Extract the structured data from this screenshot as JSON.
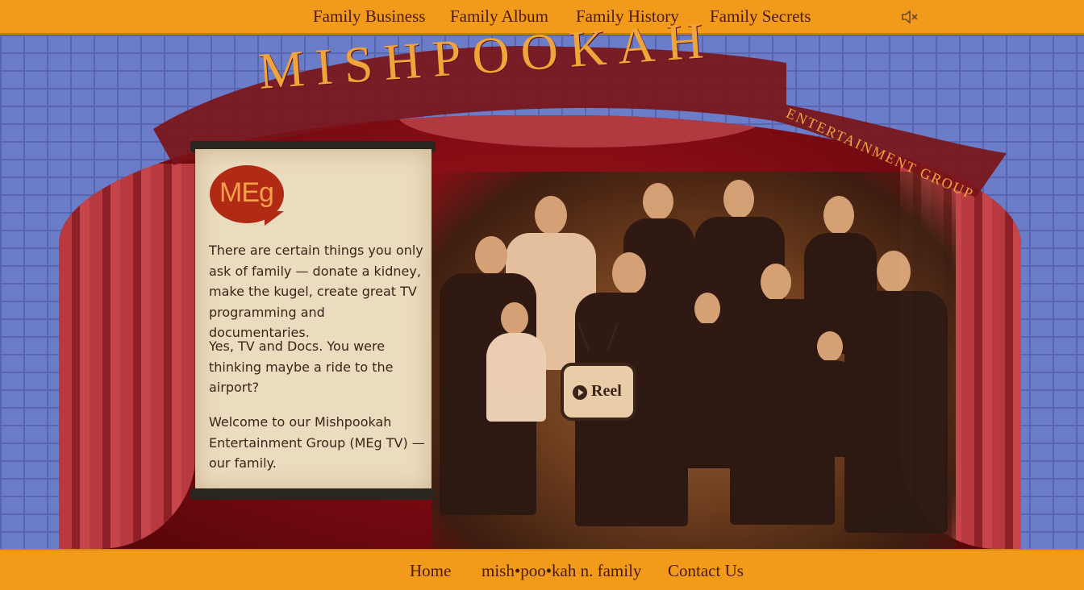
{
  "top_nav": {
    "links": [
      "Family Business",
      "Family Album",
      "Family History",
      "Family Secrets"
    ],
    "mute_icon": "speaker-muted-icon"
  },
  "banner": {
    "title": "MISHPOOKAH",
    "subtitle": "ENTERTAINMENT GROUP"
  },
  "logo": {
    "text": "MEg"
  },
  "intro": {
    "paragraphs": [
      "There are certain things you only ask of family — donate a kidney, make the kugel, create great TV programming and documentaries.",
      "Yes, TV and Docs. You were thinking maybe a ride to the airport?",
      "Welcome to our Mishpookah Entertainment Group (MEg TV) — our family."
    ]
  },
  "reel": {
    "label": "Reel",
    "icon": "play-circle-icon"
  },
  "bottom_nav": {
    "links": [
      "Home",
      "mish•poo•kah n. family",
      "Contact Us"
    ]
  },
  "colors": {
    "nav_bar": "#f29a1a",
    "nav_text": "#4a1a10",
    "wall": "#6b7cc8",
    "stage_red": "#a3141c",
    "scroll_paper": "#ecdcbf",
    "banner_text": "#f0a43a"
  }
}
